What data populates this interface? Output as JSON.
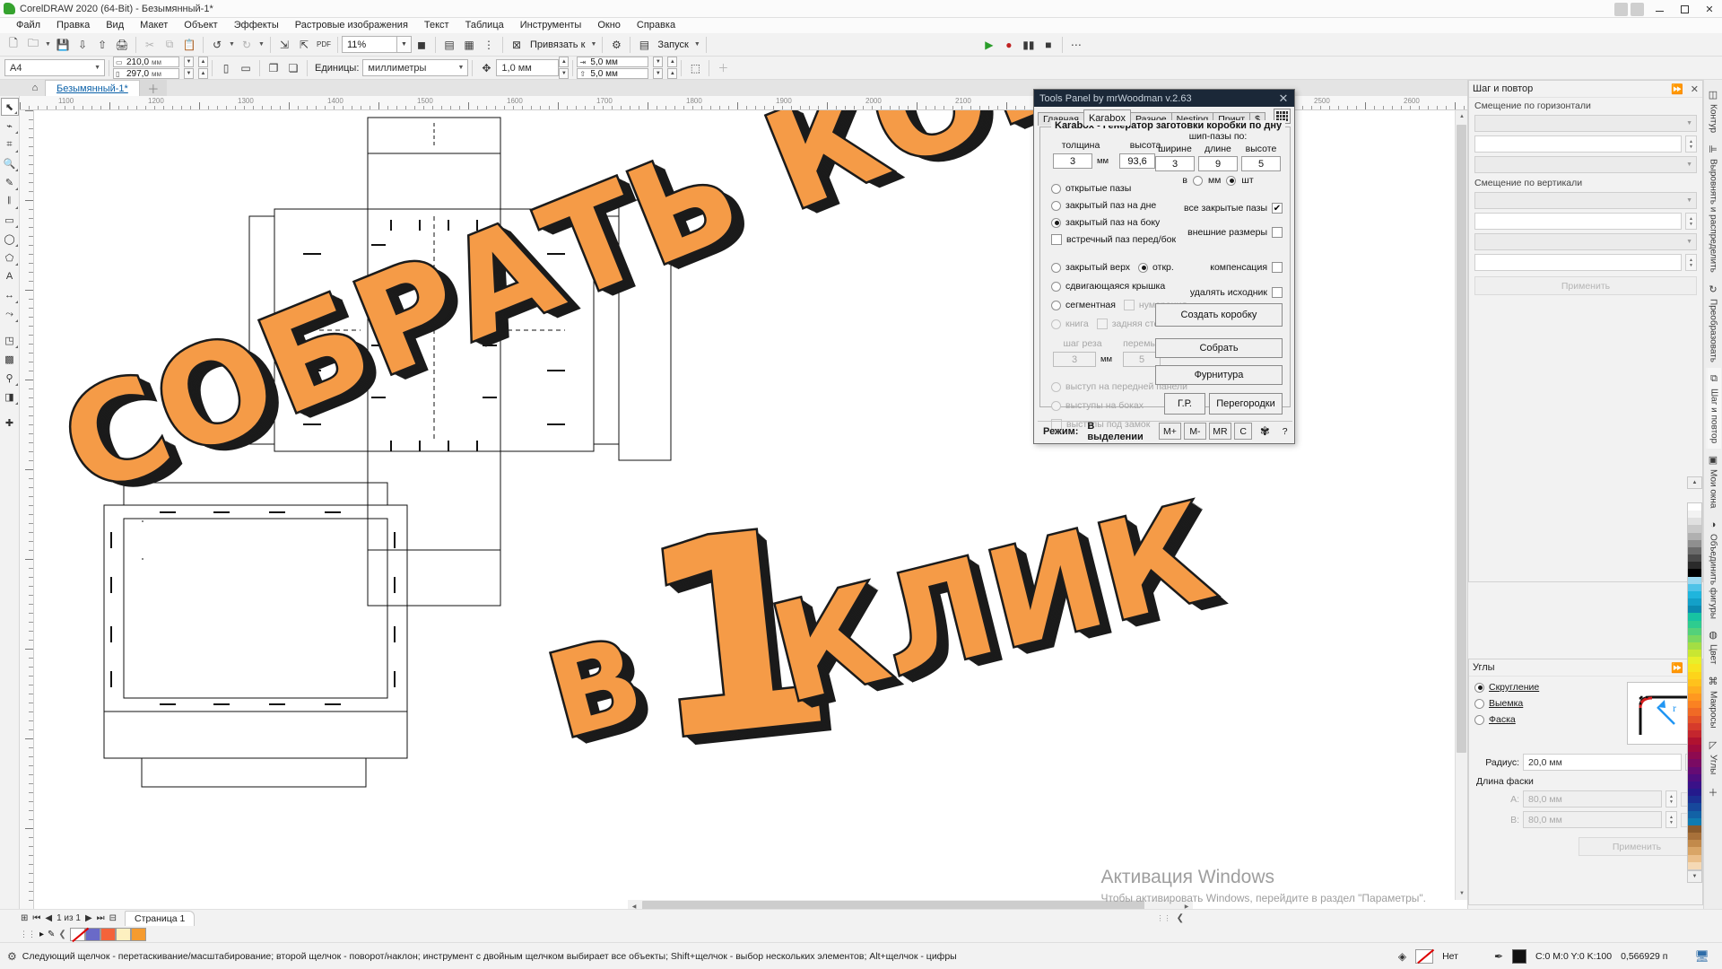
{
  "window": {
    "title": "CorelDRAW 2020 (64-Bit) - Безымянный-1*",
    "logo_color": "#35a22e"
  },
  "menubar": {
    "items": [
      "Файл",
      "Правка",
      "Вид",
      "Макет",
      "Объект",
      "Эффекты",
      "Растровые изображения",
      "Текст",
      "Таблица",
      "Инструменты",
      "Окно",
      "Справка"
    ]
  },
  "toolbar": {
    "zoom_level": "11%",
    "snap_label": "Привязать к",
    "run_label": "Запуск"
  },
  "propertybar": {
    "page_size": "A4",
    "width": "210,0",
    "height": "297,0",
    "unit_mm": "мм",
    "units_label": "Единицы:",
    "units_value": "миллиметры",
    "nudge": "1,0 мм",
    "duplicate_x": "5,0 мм",
    "duplicate_y": "5,0 мм"
  },
  "document": {
    "tab_label": "Безымянный-1*",
    "page_tab": "Страница 1",
    "page_nav": "1 из 1"
  },
  "toolspanel": {
    "title": "Tools Panel by mrWoodman v.2.63",
    "tabs": [
      "Главная",
      "Karabox",
      "Разное",
      "Nesting",
      "Принт",
      "$"
    ],
    "selected_tab": "Karabox",
    "group_title": "Karabox - Генератор заготовки коробки по дну",
    "fields": {
      "thickness_label": "толщина",
      "thickness_value": "3",
      "thickness_unit": "мм",
      "height_label": "высота",
      "height_value": "93,6",
      "height_unit": "мм",
      "tenon_title": "шип-пазы по:",
      "tenon_width_label": "ширине",
      "tenon_width_value": "3",
      "tenon_length_label": "длине",
      "tenon_length_value": "9",
      "tenon_height_label": "высоте",
      "tenon_height_value": "5",
      "in_label": "в",
      "unit_mm_label": "мм",
      "unit_pcs_label": "шт",
      "cut_step_label": "шаг реза",
      "cut_step_value": "3",
      "cut_step_unit": "мм",
      "bridge_label": "перемычек",
      "bridge_value": "5"
    },
    "options": {
      "open_slots": "открытые пазы",
      "closed_slot_bottom": "закрытый паз на дне",
      "closed_slot_side": "закрытый паз на боку",
      "counter_slot": "встречный паз перед/бок",
      "closed_top": "закрытый верх",
      "open_top": "откр.",
      "sliding_lid": "сдвигающаяся крышка",
      "segmented": "сегментная",
      "numbering": "нумерация",
      "book": "книга",
      "back_wall": "задняя стенка",
      "front_panel_tab": "выступ на передней панели",
      "side_tabs": "выступы на боках",
      "lock_tabs": "выступы под замок",
      "all_closed_slots": "все закрытые пазы",
      "outer_dimensions": "внешние размеры",
      "compensation": "компенсация",
      "delete_source": "удалять исходник"
    },
    "buttons": {
      "create_box": "Создать коробку",
      "assemble": "Собрать",
      "hardware": "Фурнитура",
      "gr": "Г.Р.",
      "partitions": "Перегородки"
    },
    "status": {
      "mode_label": "Режим:",
      "mode_value": "В выделении",
      "m_plus": "M+",
      "m_minus": "M-",
      "mr": "MR",
      "c": "C",
      "help": "?"
    }
  },
  "dockers": {
    "step_repeat": {
      "title": "Шаг и повтор",
      "horizontal_group": "Смещение по горизонтали",
      "vertical_group": "Смещение по вертикали",
      "apply": "Применить"
    },
    "corners": {
      "title": "Углы",
      "fillet": "Скругление",
      "scallop": "Выемка",
      "chamfer": "Фаска",
      "radius_label": "Радиус:",
      "radius_value": "20,0 мм",
      "chamfer_len_label": "Длина фаски",
      "a_label": "A:",
      "a_value": "80,0 мм",
      "b_label": "B:",
      "b_value": "80,0 мм",
      "apply": "Применить"
    },
    "sidetabs": [
      "Контур",
      "Выровнять и распределить",
      "Преобразовать",
      "Шаг и повтор",
      "Мои окна",
      "Объединить фигуры",
      "Цвет",
      "Макросы",
      "Углы"
    ]
  },
  "statusbar": {
    "hint": "Следующий щелчок - перетаскивание/масштабирование; второй щелчок - поворот/наклон; инструмент с двойным щелчком выбирает все объекты; Shift+щелчок - выбор нескольких элементов; Alt+щелчок - цифры",
    "fill_none": "Нет",
    "outline_color": "C:0 M:0 Y:0 K:100",
    "outline_width": "0,566929 п"
  },
  "watermark": {
    "line1": "Активация Windows",
    "line2": "Чтобы активировать Windows, перейдите в раздел \"Параметры\"."
  },
  "promo": {
    "line1": "СОБРАТЬ КОРОБКУ",
    "line2_prefix": "В",
    "line2_number": "1",
    "line2_suffix": "КЛИК",
    "fill": "#F59B47",
    "shadow": "#1b1b1b"
  },
  "palette_colors": [
    "#ffffff",
    "#f2f2f2",
    "#e0e0e0",
    "#c9c9c9",
    "#b0b0b0",
    "#8f8f8f",
    "#6b6b6b",
    "#4a4a4a",
    "#2a2a2a",
    "#000000",
    "#9ad8f0",
    "#4fc3e8",
    "#1fb5dd",
    "#13a0c8",
    "#0b8ab0",
    "#17c3a2",
    "#2ecc8f",
    "#54d17a",
    "#7ad85f",
    "#a3de44",
    "#c9e632",
    "#e8ef2a",
    "#f7e41f",
    "#fdd41a",
    "#ffc21c",
    "#ffae1e",
    "#ff9820",
    "#fa8222",
    "#f06a25",
    "#e35228",
    "#d63b2b",
    "#c4262e",
    "#b01230",
    "#a00b3d",
    "#8e0a50",
    "#7a0a63",
    "#650b74",
    "#4e0d7f",
    "#3a1188",
    "#241a8c",
    "#1b2f93",
    "#16489c",
    "#1262a6",
    "#0f7bb0",
    "#8a5a2b",
    "#a8713a",
    "#c28a4b",
    "#d9a566",
    "#ebbf8a",
    "#f5d9b5"
  ]
}
